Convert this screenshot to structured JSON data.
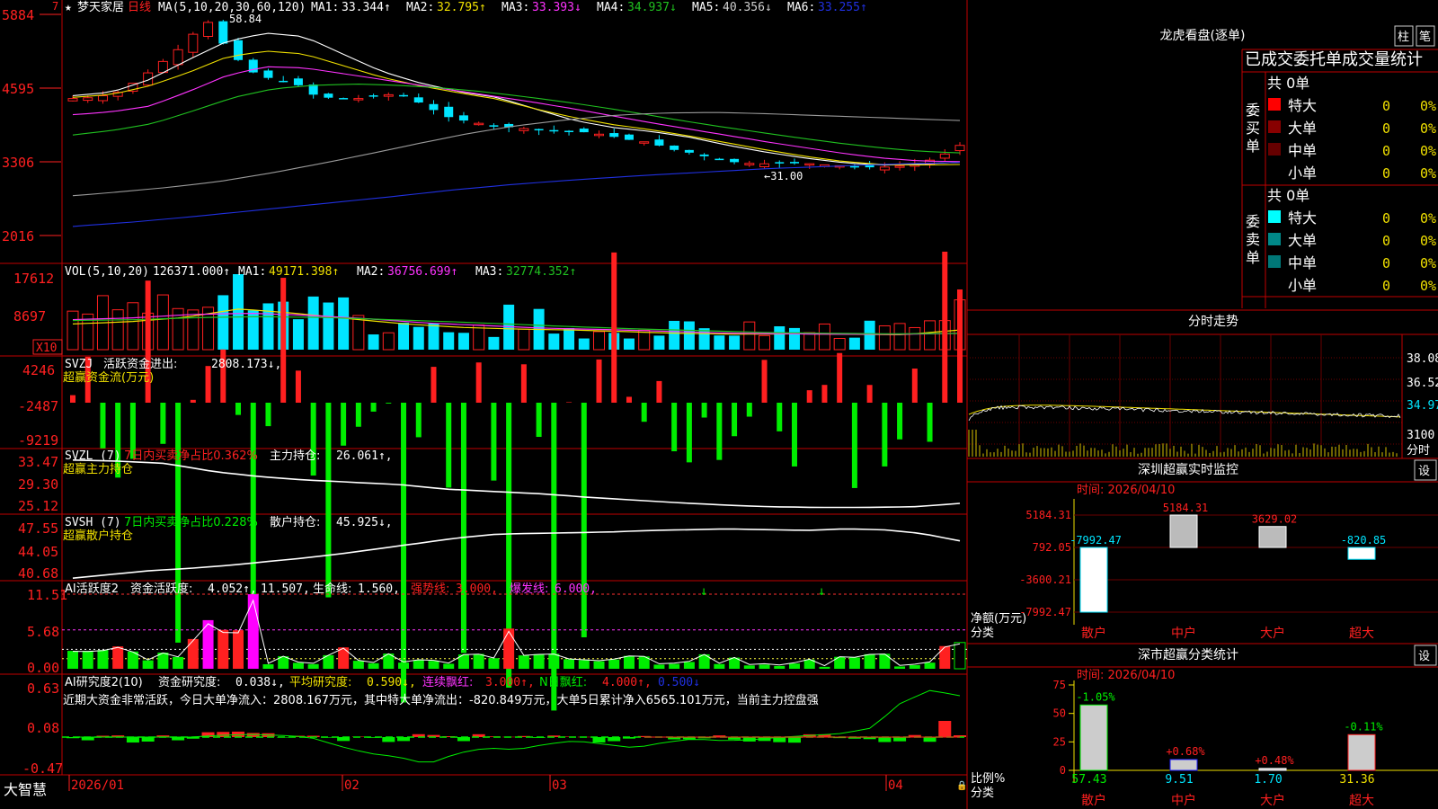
{
  "app": {
    "brand": "大智慧"
  },
  "colors": {
    "up": "#ff2020",
    "down": "#00e5ff",
    "green": "#00ee00",
    "border": "#c00000",
    "ma_white": "#ffffff",
    "ma_yellow": "#f0e000",
    "ma_magenta": "#ff33ff",
    "ma_green": "#20c020",
    "ma_gray": "#9a9a9a",
    "ma_blue": "#2030e0"
  },
  "main": {
    "star": "★",
    "stock": "梦天家居",
    "period": "日线",
    "ma_title": "MA(5,10,20,30,60,120)",
    "ma_values": [
      {
        "label": "MA1:",
        "value": "33.344↑",
        "color": "#ffffff"
      },
      {
        "label": "MA2:",
        "value": "32.795↑",
        "color": "#f0e000"
      },
      {
        "label": "MA3:",
        "value": "33.393↓",
        "color": "#ff33ff"
      },
      {
        "label": "MA4:",
        "value": "34.937↓",
        "color": "#20c020"
      },
      {
        "label": "MA5:",
        "value": "40.356↓",
        "color": "#cfcfcf"
      },
      {
        "label": "MA6:",
        "value": "33.255↑",
        "color": "#2030e0"
      }
    ],
    "y_ticks": [
      "5884",
      "4595",
      "3306",
      "2016"
    ],
    "high_mark": "58.84",
    "low_mark": "←31.00",
    "top_left_mark": "7"
  },
  "vol": {
    "title": "VOL(5,10,20)",
    "value": "126371.000↑",
    "ma": [
      {
        "label": "MA1:",
        "value": "49171.398↑",
        "color": "#f0e000"
      },
      {
        "label": "MA2:",
        "value": "36756.699↑",
        "color": "#ff33ff"
      },
      {
        "label": "MA3:",
        "value": "32774.352↑",
        "color": "#20c020"
      }
    ],
    "y_ticks": [
      "17612",
      "8697"
    ],
    "unit": "X10"
  },
  "svzj": {
    "title": "SVZJ",
    "label": "活跃资金进出:",
    "value": "2808.173↓,",
    "subtitle": "超赢资金流(万元)",
    "y_ticks": [
      "4246",
      "-2487",
      "-9219"
    ]
  },
  "svzl": {
    "title": "SVZL (7)",
    "ratio": "7日内买卖净占比0.362%",
    "label": "主力持仓:",
    "value": "26.061↑,",
    "subtitle": "超赢主力持仓",
    "y_ticks": [
      "33.47",
      "29.30",
      "25.12"
    ]
  },
  "svsh": {
    "title": "SVSH (7)",
    "ratio": "7日内买卖净占比0.228%",
    "label": "散户持仓:",
    "value": "45.925↓,",
    "subtitle": "超赢散户持仓",
    "y_ticks": [
      "47.55",
      "44.05",
      "40.68"
    ]
  },
  "ai_active": {
    "title": "AI活跃度2",
    "label": "资金活跃度:",
    "value": "4.052↑,",
    "v2": "11.507,",
    "life_label": "生命线:",
    "life_value": "1.560,",
    "strong_label": "强势线:",
    "strong_value": "3.000,",
    "burst_label": "爆发线:",
    "burst_value": "6.000,",
    "y_ticks": [
      "11.51",
      "5.68",
      "0.00"
    ]
  },
  "ai_research": {
    "title": "AI研究度2(10)",
    "label": "资金研究度:",
    "value": "0.038↓,",
    "avg_label": "平均研究度:",
    "avg_value": "0.590↓,",
    "red_label": "连续飘红:",
    "red_value": "3.000↑,",
    "n_label": "N日飘红:",
    "n_value": "4.000↑,",
    "last_value": "0.500↓",
    "comment": "近期大资金非常活跃，今日大单净流入：2808.167万元，其中特大单净流出：-820.849万元，大单5日累计净入6565.101万元，当前主力控盘强",
    "y_ticks": [
      "0.63",
      "0.08",
      "-0.47"
    ]
  },
  "x_axis": [
    "2026/01",
    "02",
    "03",
    "04"
  ],
  "right": {
    "longhu_title": "龙虎看盘(逐单)",
    "btn_column": "柱",
    "btn_stroke": "笔",
    "stat_title": "已成交委托单成交量统计",
    "buy_side": "委买单",
    "sell_side": "委卖单",
    "buy_total": "共 0单",
    "sell_total": "共 0单",
    "buy_rows": [
      {
        "name": "特大",
        "count": "0",
        "pct": "0%",
        "color": "#ff0000"
      },
      {
        "name": "大单",
        "count": "0",
        "pct": "0%",
        "color": "#880000"
      },
      {
        "name": "中单",
        "count": "0",
        "pct": "0%",
        "color": "#660000"
      },
      {
        "name": "小单",
        "count": "0",
        "pct": "0%",
        "color": ""
      }
    ],
    "sell_rows": [
      {
        "name": "特大",
        "count": "0",
        "pct": "0%",
        "color": "#00ffff"
      },
      {
        "name": "大单",
        "count": "0",
        "pct": "0%",
        "color": "#008888"
      },
      {
        "name": "中单",
        "count": "0",
        "pct": "0%",
        "color": "#007777"
      },
      {
        "name": "小单",
        "count": "0",
        "pct": "0%",
        "color": ""
      }
    ],
    "intraday_title": "分时走势",
    "intraday_ticks": [
      "38.08",
      "36.52",
      "34.97",
      "3100",
      "分时"
    ],
    "monitor_title": "深圳超赢实时监控",
    "monitor_btn": "设",
    "monitor_time": "时间: 2026/04/10",
    "monitor_y": [
      "5184.31",
      "792.05",
      "-3600.21",
      "-7992.47"
    ],
    "monitor_unit": "净额(万元)",
    "monitor_unit2": "分类",
    "classify_title": "深市超赢分类统计",
    "classify_btn": "设",
    "classify_time": "时间: 2026/04/10",
    "classify_y": [
      "75",
      "50",
      "25",
      "0"
    ],
    "classify_unit": "比例%",
    "classify_unit2": "分类"
  },
  "chart_data": [
    {
      "type": "bar",
      "title": "深圳超赢实时监控",
      "ylabel": "净额(万元)",
      "categories": [
        "散户",
        "中户",
        "大户",
        "超大"
      ],
      "values": [
        -7992.47,
        5184.31,
        3629.02,
        -820.85
      ],
      "value_labels": [
        "-7992.47",
        "5184.31",
        "3629.02",
        "-820.85"
      ],
      "ylim": [
        -7992.47,
        5184.31
      ]
    },
    {
      "type": "bar",
      "title": "深市超赢分类统计",
      "ylabel": "比例%",
      "categories": [
        "散户",
        "中户",
        "大户",
        "超大"
      ],
      "values": [
        57.43,
        9.51,
        1.7,
        31.36
      ],
      "changes": [
        "-1.05%",
        "+0.68%",
        "+0.48%",
        "-0.11%"
      ],
      "value_labels": [
        "57.43",
        "9.51",
        "1.70",
        "31.36"
      ],
      "ylim": [
        0,
        75
      ]
    }
  ]
}
